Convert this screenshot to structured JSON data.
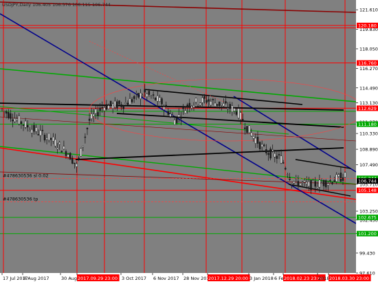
{
  "chart_data": {
    "type": "candlestick",
    "header": "USDJPY,Daily 106.405 106.576 106.115 106.744",
    "y_range": [
      97.61,
      122.5
    ],
    "price_ticks": [
      "121.610",
      "119.830",
      "118.050",
      "116.270",
      "114.490",
      "113.130",
      "111.370",
      "110.330",
      "108.890",
      "107.490",
      "105.710",
      "103.250",
      "102.450",
      "101.210",
      "99.430",
      "97.610"
    ],
    "date_labels": [
      "17 Jul 2017",
      "8 Aug 2017",
      "30 Aug 2017",
      "2017.09.29 23:00",
      "3 Oct 2017",
      "6 Nov 2017",
      "28 Nov 2017",
      "2017.12.29 20:00",
      "3 Jan 2018",
      "6 Feb 2018",
      "2018.02.23 23:00",
      "2018",
      "2018.03.30 23:00"
    ],
    "highlighted_dates": [
      "2017.09.29 23:00",
      "2017.12.29 20:00",
      "2018.02.23 23:00",
      "2018.03.30 23:00"
    ],
    "price_tags": [
      {
        "value": "120.180",
        "price": 120.18,
        "color": "#ff0000"
      },
      {
        "value": "116.760",
        "price": 116.76,
        "color": "#ff0000"
      },
      {
        "value": "112.629",
        "price": 112.63,
        "color": "#ff0000"
      },
      {
        "value": "111.180",
        "price": 111.18,
        "color": "#00aa00"
      },
      {
        "value": "106.244",
        "price": 106.24,
        "color": "#00aa00"
      },
      {
        "value": "105.148",
        "price": 105.15,
        "color": "#ff0000"
      },
      {
        "value": "102.675",
        "price": 102.68,
        "color": "#00aa00"
      },
      {
        "value": "101.200",
        "price": 101.2,
        "color": "#00aa00"
      }
    ],
    "current_price_tag": {
      "value": "106.744",
      "price": 106.0
    },
    "order_labels": [
      "#478630536 sl 0.02",
      "#478630536 tp"
    ],
    "colors": {
      "background": "#808080",
      "bull": "#1a1a1a",
      "bear": "#1a1a1a",
      "support_resistance": "#ff0000",
      "green_levels": "#00aa00",
      "channel_blue": "#00008b",
      "trend_black": "#000000",
      "trend_darkred": "#8b0000"
    }
  }
}
